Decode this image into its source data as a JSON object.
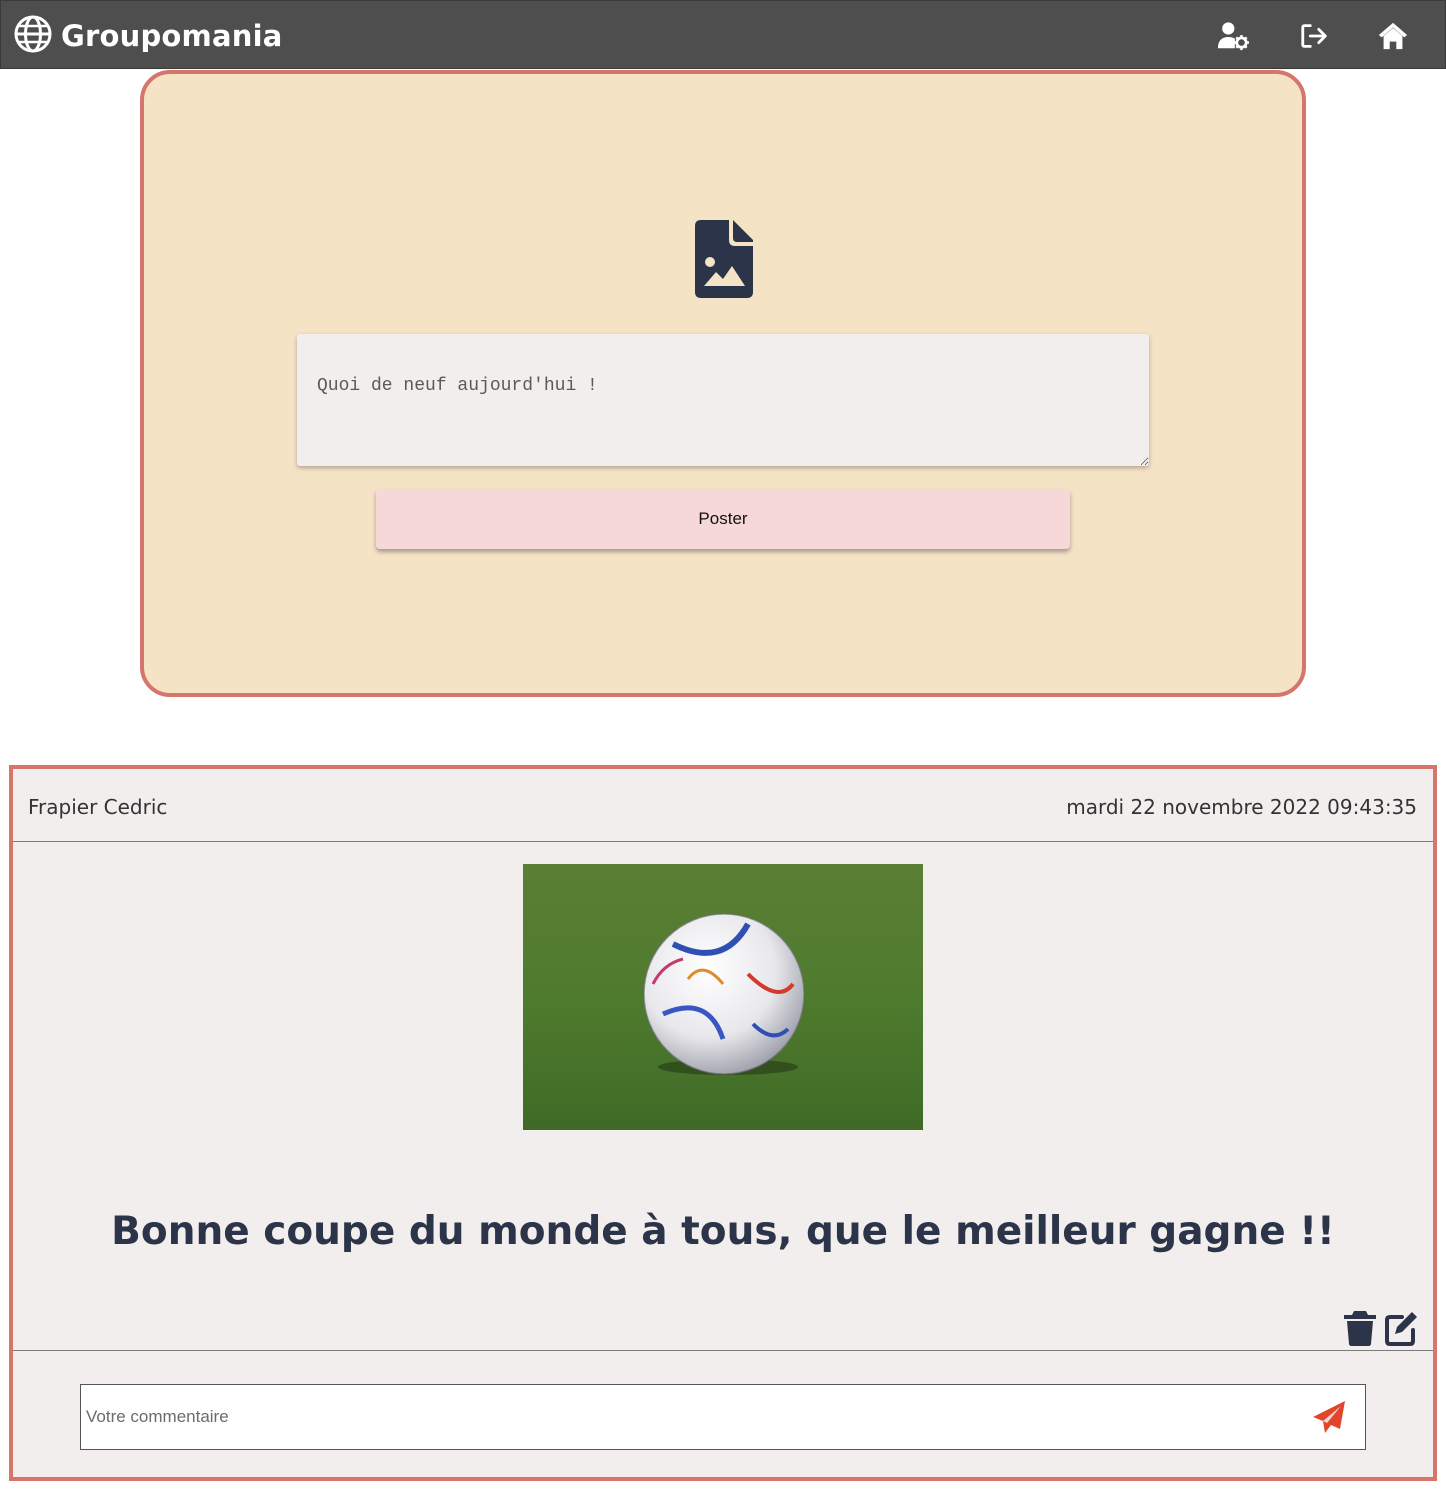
{
  "navbar": {
    "brand_name": "Groupomania",
    "icons": {
      "brand": "globe-icon",
      "profile": "user-settings-icon",
      "logout": "logout-icon",
      "home": "home-icon"
    }
  },
  "compose": {
    "upload_icon": "file-image-icon",
    "textarea_value": "",
    "textarea_placeholder": "Quoi de neuf aujourd'hui !",
    "post_button_label": "Poster"
  },
  "post": {
    "author": "Frapier Cedric",
    "date": "mardi 22 novembre 2022 09:43:35",
    "message": "Bonne coupe du monde à tous, que le meilleur gagne !!",
    "actions": [
      "trash-icon",
      "edit-icon"
    ],
    "comment_placeholder": "Votre commentaire",
    "comment_value": "",
    "send_icon": "paper-plane-icon"
  },
  "colors": {
    "navbar_bg": "#4e4e4e",
    "compose_bg": "#f5e3c6",
    "card_border": "#d5756b",
    "post_bg": "#f3eeee",
    "button_bg": "#f7d8d8",
    "icon_dark": "#2b3448",
    "send_icon": "#e2452b"
  }
}
